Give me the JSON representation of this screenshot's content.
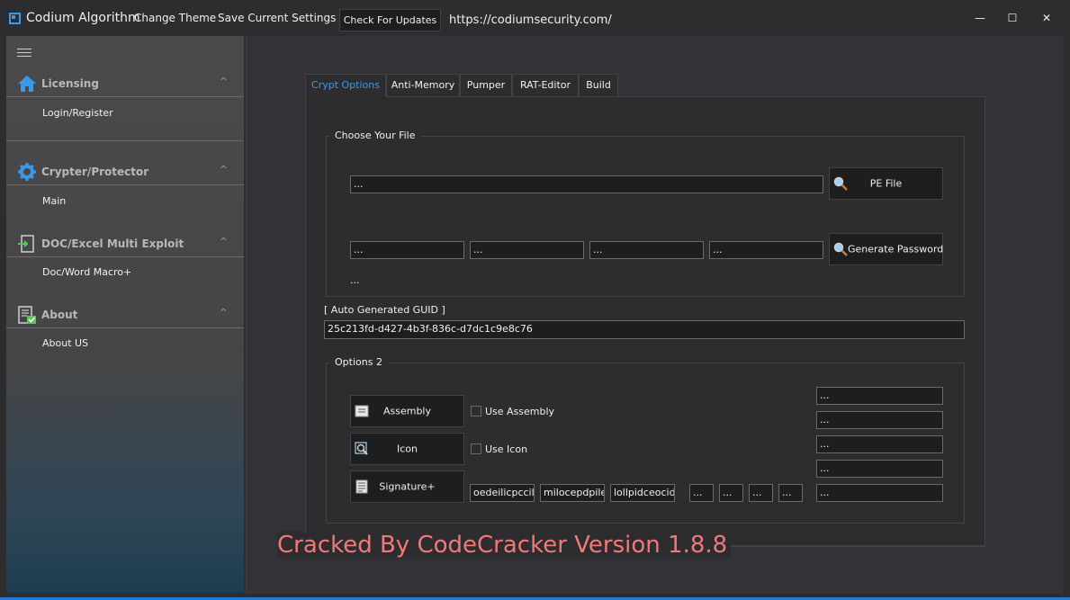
{
  "titlebar": {
    "app_title": "Codium Algorithm",
    "menu": [
      "Change Theme",
      "Save Current Settings"
    ],
    "check_updates": "Check For Updates",
    "url": "https://codiumsecurity.com/",
    "minimize": "—",
    "maximize": "☐",
    "close": "✕"
  },
  "sidebar": {
    "sections": [
      {
        "title": "Licensing",
        "icon": "home-icon",
        "items": [
          "Login/Register"
        ]
      },
      {
        "title": "Crypter/Protector",
        "icon": "gear-icon",
        "items": [
          "Main"
        ]
      },
      {
        "title": "DOC/Excel Multi Exploit",
        "icon": "exploit-icon",
        "items": [
          "Doc/Word Macro+"
        ]
      },
      {
        "title": "About",
        "icon": "checklist-icon",
        "items": [
          "About US"
        ]
      }
    ],
    "chevron": "^"
  },
  "tabs": [
    "Crypt Options",
    "Anti-Memory",
    "Pumper",
    "RAT-Editor",
    "Build"
  ],
  "choose_file": {
    "label": "Choose Your File",
    "file_path": "...",
    "pe_button": "PE File",
    "password_fields": [
      "...",
      "...",
      "...",
      "..."
    ],
    "generate_button": "Generate Password",
    "password_note": "..."
  },
  "guid": {
    "label": "[ Auto Generated GUID ]",
    "value": "25c213fd-d427-4b3f-836c-d7dc1c9e8c76"
  },
  "options2": {
    "label": "Options 2",
    "assembly_button": "Assembly",
    "use_assembly": "Use Assembly",
    "icon_button": "Icon",
    "use_icon": "Use Icon",
    "signature_button": "Signature+",
    "signature_fields": [
      "oedeilicpccillmp",
      "milocepdpileioc",
      "lollpidceocidop"
    ],
    "small_fields": [
      "...",
      "...",
      "...",
      "..."
    ],
    "right_fields": [
      "...",
      "...",
      "...",
      "...",
      "..."
    ]
  },
  "watermark": "Cracked By CodeCracker Version 1.8.8",
  "colors": {
    "accent": "#1e7ad6",
    "watermark": "#f07878"
  }
}
